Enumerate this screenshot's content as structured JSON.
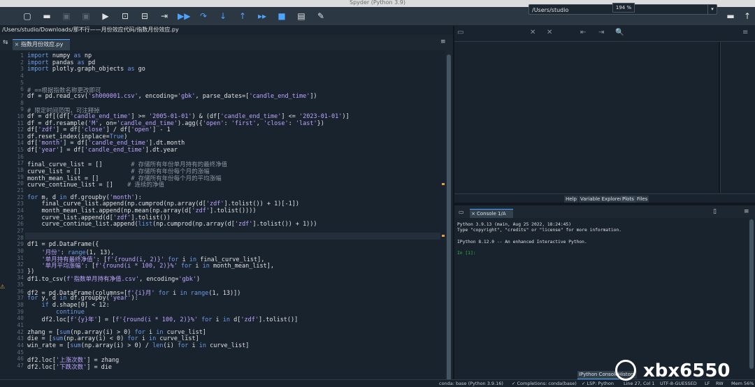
{
  "window": {
    "title": "Spyder (Python 3.9)"
  },
  "toolbar": {
    "path": "/Users/studio",
    "icons": [
      "new-file-icon",
      "open-folder-icon",
      "save-icon",
      "save-all-icon",
      "run-icon",
      "run-cell-icon",
      "run-cell-advance-icon",
      "run-selection-icon",
      "debug-icon",
      "step-icon",
      "step-into-icon",
      "step-return-icon",
      "continue-icon",
      "stop-icon",
      "maximize-pane-icon",
      "preferences-icon"
    ],
    "glyphs": [
      "▢",
      "▬",
      "▣",
      "▣",
      "▶",
      "⊡",
      "⊟",
      "⇥",
      "▶▶",
      "↷",
      "↓",
      "↑",
      "▸▸",
      "■",
      "▤",
      "✎"
    ]
  },
  "editor": {
    "filepath": "/Users/studio/Downloads/那不行——月份效应代码/指数月份效应.py",
    "tab_label": "指数月份效应.py",
    "lines": [
      {
        "n": "1",
        "html": "<span class='kw'>import</span> numpy <span class='kw'>as</span> np"
      },
      {
        "n": "2",
        "html": "<span class='kw'>import</span> pandas <span class='kw'>as</span> pd"
      },
      {
        "n": "3",
        "html": "<span class='kw'>import</span> plotly.graph_objects <span class='kw'>as</span> go"
      },
      {
        "n": "4",
        "html": ""
      },
      {
        "n": "5",
        "html": ""
      },
      {
        "n": "6",
        "html": "<span class='cm'># ==根据指数名称更改即可</span>"
      },
      {
        "n": "7",
        "html": "df = pd.read_csv(<span class='st'>'sh000001.csv'</span>, encoding=<span class='st'>'gbk'</span>, parse_dates=[<span class='st'>'candle_end_time'</span>])"
      },
      {
        "n": "8",
        "html": ""
      },
      {
        "n": "9",
        "html": "<span class='cm'># 限定时间范围，可注释掉</span>"
      },
      {
        "n": "10",
        "html": "df = df[(df[<span class='st'>'candle_end_time'</span>] &gt;= <span class='st'>'2005-01-01'</span>) &amp; (df[<span class='st'>'candle_end_time'</span>] &lt;= <span class='st'>'2023-01-01'</span>)]"
      },
      {
        "n": "11",
        "html": "df = df.resample(<span class='st'>'M'</span>, on=<span class='st'>'candle_end_time'</span>).agg({<span class='st'>'open'</span>: <span class='st'>'first'</span>, <span class='st'>'close'</span>: <span class='st'>'last'</span>})"
      },
      {
        "n": "12",
        "html": "df[<span class='st'>'zdf'</span>] = df[<span class='st'>'close'</span>] / df[<span class='st'>'open'</span>] - 1"
      },
      {
        "n": "13",
        "html": "df.reset_index(inplace=<span class='kw'>True</span>)"
      },
      {
        "n": "14",
        "html": "df[<span class='st'>'month'</span>] = df[<span class='st'>'candle_end_time'</span>].dt.month"
      },
      {
        "n": "15",
        "html": "df[<span class='st'>'year'</span>] = df[<span class='st'>'candle_end_time'</span>].dt.year"
      },
      {
        "n": "16",
        "html": ""
      },
      {
        "n": "17",
        "html": "final_curve_list = []        <span class='cm'># 存储所有年份单月持有的最终净值</span>"
      },
      {
        "n": "18",
        "html": "curve_list = []              <span class='cm'># 存储所有年份每个月的涨幅</span>"
      },
      {
        "n": "19",
        "html": "month_mean_list = []         <span class='cm'># 存储所有年份每个月的平均涨幅</span>"
      },
      {
        "n": "20",
        "html": "curve_continue_list = []    <span class='cm'># 连续的净值</span>"
      },
      {
        "n": "21",
        "html": ""
      },
      {
        "n": "22",
        "html": "<span class='kw'>for</span> m, d <span class='kw'>in</span> df.groupby(<span class='st'>'month'</span>):"
      },
      {
        "n": "23",
        "html": "    final_curve_list.append(np.cumprod(np.array(d[<span class='st'>'zdf'</span>].tolist()) + 1)[-1])"
      },
      {
        "n": "24",
        "html": "    month_mean_list.append(np.mean(np.array(d[<span class='st'>'zdf'</span>].tolist())))"
      },
      {
        "n": "25",
        "html": "    curve_list.append(d[<span class='st'>'zdf'</span>].tolist())"
      },
      {
        "n": "26",
        "html": "    curve_continue_list.append(<span class='kw'>list</span>(np.cumprod(np.array(d[<span class='st'>'zdf'</span>].tolist()) + 1)))"
      },
      {
        "n": "27",
        "html": ""
      },
      {
        "n": "28",
        "html": ""
      },
      {
        "n": "29",
        "html": "df1 = pd.DataFrame({"
      },
      {
        "n": "30",
        "html": "    <span class='st'>'月份'</span>: <span class='kw'>range</span>(1, 13),"
      },
      {
        "n": "31",
        "html": "    <span class='st'>'单月持有最终净值'</span>: [<span class='st'>f'{round(i, 2)}'</span> <span class='kw'>for</span> i <span class='kw'>in</span> final_curve_list],"
      },
      {
        "n": "32",
        "html": "    <span class='st'>'单月平均涨幅'</span>: [<span class='st'>f'{round(i * 100, 2)}%'</span> <span class='kw'>for</span> i <span class='kw'>in</span> month_mean_list],"
      },
      {
        "n": "33",
        "html": "})"
      },
      {
        "n": "34",
        "html": "df1.to_csv(<span class='st'>f'指数单月持有净值.csv'</span>, encoding=<span class='st'>'gbk'</span>)"
      },
      {
        "n": "35",
        "html": ""
      },
      {
        "n": "36",
        "html": "df2 = pd.DataFrame(columns=[<span class='st'>f'{i}月'</span> <span class='kw'>for</span> i <span class='kw'>in</span> <span class='kw'>range</span>(1, 13)])"
      },
      {
        "n": "37",
        "html": "<span class='kw'>for</span> y, d <span class='kw'>in</span> df.groupby(<span class='st'>'year'</span>):"
      },
      {
        "n": "38",
        "html": "    <span class='kw'>if</span> d.shape[0] &lt; 12:"
      },
      {
        "n": "39",
        "html": "        <span class='kw'>continue</span>"
      },
      {
        "n": "40",
        "html": "    df2.loc[<span class='st'>f'{y}年'</span>] = [<span class='st'>f'{round(i * 100, 2)}%'</span> <span class='kw'>for</span> i <span class='kw'>in</span> d[<span class='st'>'zdf'</span>].tolist()]"
      },
      {
        "n": "41",
        "html": ""
      },
      {
        "n": "42",
        "html": "zhang = [<span class='kw'>sum</span>(np.array(i) &gt; 0) <span class='kw'>for</span> i <span class='kw'>in</span> curve_list]"
      },
      {
        "n": "43",
        "html": "die = [<span class='kw'>sum</span>(np.array(i) &lt; 0) <span class='kw'>for</span> i <span class='kw'>in</span> curve_list]"
      },
      {
        "n": "44",
        "html": "win_rate = [<span class='kw'>sum</span>(np.array(i) &gt; 0) / <span class='kw'>len</span>(i) <span class='kw'>for</span> i <span class='kw'>in</span> curve_list]"
      },
      {
        "n": "45",
        "html": ""
      },
      {
        "n": "46",
        "html": "df2.loc[<span class='st'>'上涨次数'</span>] = zhang"
      },
      {
        "n": "47",
        "html": "df2.loc[<span class='st'>'下跌次数'</span>] = die"
      }
    ]
  },
  "plots": {
    "zoom": "194 %"
  },
  "pane_tabs": [
    "Help",
    "Variable Explorer",
    "Plots",
    "Files"
  ],
  "console": {
    "tab_label": "Console 1/A",
    "lines": [
      "Python 3.9.13 (main, Aug 25 2022, 18:24:45)",
      "Type \"copyright\", \"credits\" or \"license\" for more information.",
      "",
      "IPython 8.12.0 -- An enhanced Interactive Python.",
      "",
      "In [1]:"
    ]
  },
  "bottom_tabs": [
    "IPython Console",
    "History"
  ],
  "status": {
    "conda": "conda: base (Python 3.9.16)",
    "completions": "✓ Completions: conda(base)",
    "lsp": "✓ LSP: Python",
    "position": "Line 27, Col 1",
    "encoding": "UTF-8-GUESSED",
    "eol": "LF",
    "rw": "RW",
    "mem": "Mem 56%"
  },
  "watermark": {
    "text": "xbx6550"
  }
}
